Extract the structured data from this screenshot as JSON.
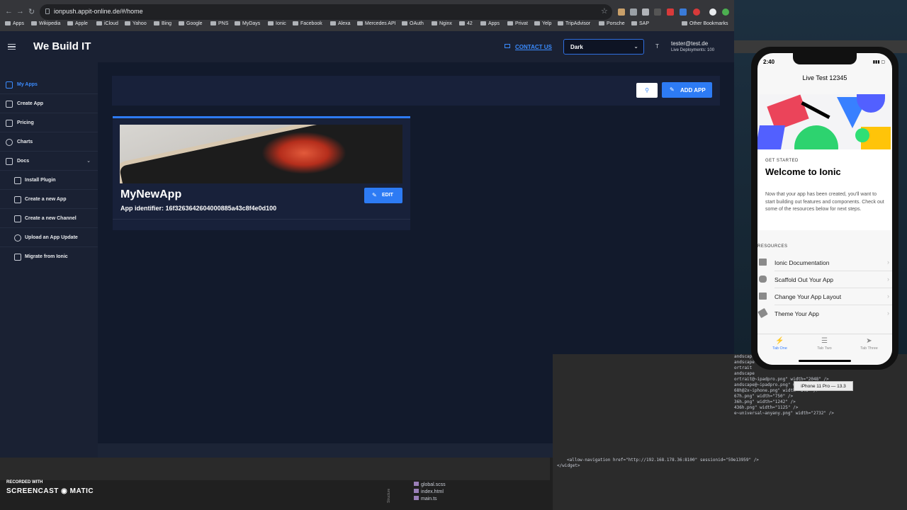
{
  "browser": {
    "url": "ionpush.appit-online.de/#/home",
    "bookmarks": [
      "Apps",
      "Wikipedia",
      "Apple",
      "iCloud",
      "Yahoo",
      "Bing",
      "Google",
      "PNS",
      "MyDays",
      "Ionic",
      "Facebook",
      "Alexa",
      "Mercedes API",
      "OAuth",
      "Nginx",
      "42",
      "Apps",
      "Privat",
      "Yelp",
      "TripAdvisor",
      "Porsche",
      "SAP"
    ],
    "other_bookmarks": "Other Bookmarks"
  },
  "header": {
    "brand": "We Build IT",
    "contact": "CONTACT US",
    "theme_value": "Dark",
    "avatar_initial": "T",
    "user_email": "tester@test.de",
    "deployments": "Live Deployments: 100"
  },
  "sidebar": {
    "items": [
      {
        "label": "My Apps",
        "icon": "home-icon"
      },
      {
        "label": "Create App",
        "icon": "pencil-icon"
      },
      {
        "label": "Pricing",
        "icon": "card-icon"
      },
      {
        "label": "Charts",
        "icon": "chart-icon"
      },
      {
        "label": "Docs",
        "icon": "docs-icon"
      },
      {
        "label": "Install Plugin",
        "icon": "book-icon"
      },
      {
        "label": "Create a new App",
        "icon": "pencil-icon"
      },
      {
        "label": "Create a new Channel",
        "icon": "pencil-icon"
      },
      {
        "label": "Upload an App Update",
        "icon": "cloud-upload-icon"
      },
      {
        "label": "Migrate from Ionic",
        "icon": "migrate-icon"
      }
    ]
  },
  "main": {
    "search_icon": "search-icon",
    "add_app": "ADD APP",
    "card": {
      "app_name": "MyNewApp",
      "app_identifier": "App identifier: 16f3263642604000885a43c8f4e0d100",
      "edit": "EDIT"
    }
  },
  "recorder": {
    "recorded_with": "RECORDED WITH",
    "brand": "SCREENCAST ◉ MATIC"
  },
  "ide": {
    "files": [
      "global.scss",
      "index.html",
      "main.ts"
    ],
    "structure": "Structure",
    "code_lines": [
      "andscape",
      "andscape",
      "ortrait",
      "andscape",
      "ortrait@~ipadpro.png\" width=\"2048\" />",
      "andscape@~ipadpro.png\" width=\"2732\" />",
      "68h@2x~iphone.png\" width=\"640\" />",
      "67h.png\" width=\"750\" />",
      "36h.png\" width=\"1242\" />",
      "436h.png\" width=\"1125\" />",
      "e~universal~anyany.png\" width=\"2732\" />"
    ],
    "code_tail": [
      "<allow-navigation href=\"http://192.168.178.36:8100\" sessionid=\"59e13959\" />",
      "</widget>"
    ]
  },
  "simulator": {
    "device_label": "iPhone 11 Pro — 13.3",
    "time": "2:40",
    "title": "Live Test 12345",
    "get_started": "GET STARTED",
    "welcome": "Welcome to Ionic",
    "intro": "Now that your app has been created, you'll want to start building out features and components. Check out some of the resources below for next steps.",
    "resources_label": "RESOURCES",
    "resources": [
      {
        "label": "Ionic Documentation",
        "icon": "book-icon"
      },
      {
        "label": "Scaffold Out Your App",
        "icon": "wrench-icon"
      },
      {
        "label": "Change Your App Layout",
        "icon": "grid-icon"
      },
      {
        "label": "Theme Your App",
        "icon": "paint-icon"
      }
    ],
    "tabs": [
      {
        "label": "Tab One",
        "icon": "flash-icon"
      },
      {
        "label": "Tab Two",
        "icon": "layers-icon"
      },
      {
        "label": "Tab Three",
        "icon": "send-icon"
      }
    ]
  }
}
